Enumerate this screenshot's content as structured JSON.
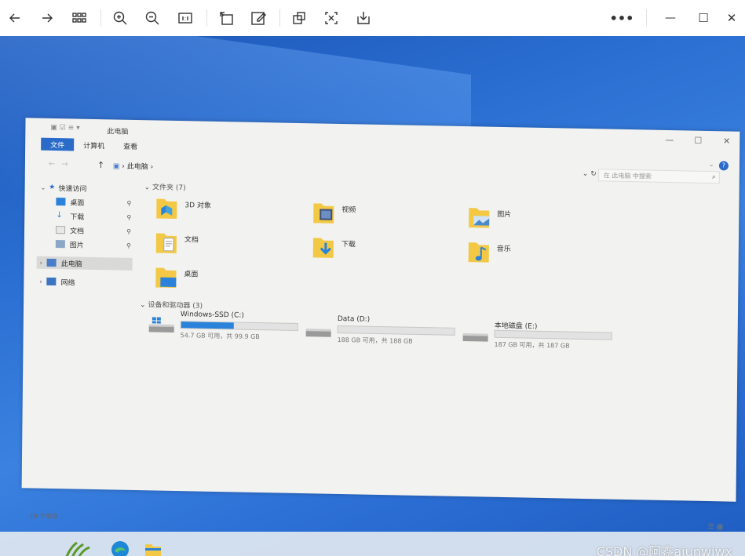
{
  "viewer": {
    "tools": [
      "back",
      "forward",
      "grid-view",
      "zoom-in",
      "zoom-out",
      "actual-size",
      "rotate",
      "edit",
      "screen-capture",
      "ocr",
      "download"
    ],
    "more": "•••",
    "minimize": "—",
    "maximize": "☐",
    "close": "✕"
  },
  "explorer": {
    "title": "此电脑",
    "tabs": [
      "文件",
      "计算机",
      "查看"
    ],
    "address": "此电脑",
    "search_placeholder": "在 此电脑 中搜索",
    "sidebar": {
      "quick_access": "快速访问",
      "items": [
        "桌面",
        "下载",
        "文档",
        "图片"
      ],
      "this_pc": "此电脑",
      "network": "网络"
    },
    "folders_header": "文件夹 (7)",
    "folders": [
      "3D 对象",
      "视频",
      "图片",
      "文档",
      "下载",
      "音乐",
      "桌面"
    ],
    "drives_header": "设备和驱动器 (3)",
    "drives": [
      {
        "name": "Windows-SSD (C:)",
        "free": "54.7 GB 可用，共 99.9 GB",
        "used_fraction": 0.45
      },
      {
        "name": "Data (D:)",
        "free": "188 GB 可用，共 188 GB",
        "used_fraction": 0.0
      },
      {
        "name": "本地磁盘 (E:)",
        "free": "187 GB 可用，共 187 GB",
        "used_fraction": 0.0
      }
    ],
    "status": "10 个项目"
  },
  "watermark": "CSDN @阿鑫ajunwiwx",
  "colors": {
    "accent": "#2a6bc9",
    "drive_fill": "#2a82da",
    "desktop": "#2a6ed1"
  }
}
